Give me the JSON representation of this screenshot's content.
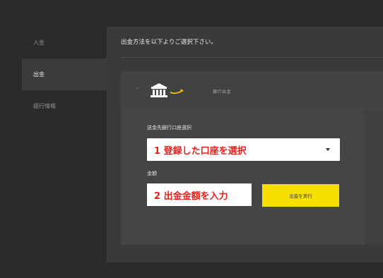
{
  "sidebar": {
    "items": [
      {
        "label": "入金",
        "active": false
      },
      {
        "label": "出金",
        "active": true
      },
      {
        "label": "銀行情報",
        "active": false
      }
    ]
  },
  "main": {
    "instruction": "出金方法を以下よりご選択下さい。",
    "method": {
      "icon": "bank-icon",
      "label": "銀行出金"
    },
    "account_select": {
      "label": "送金先銀行口座選択",
      "value": "1 登録した口座を選択"
    },
    "amount": {
      "label": "金額",
      "value": "2 出金金額を入力"
    },
    "execute_button": "出金を実行"
  },
  "colors": {
    "accent_yellow": "#f7e000",
    "annotation_red": "#e8201c",
    "background": "#2b2b2b"
  }
}
